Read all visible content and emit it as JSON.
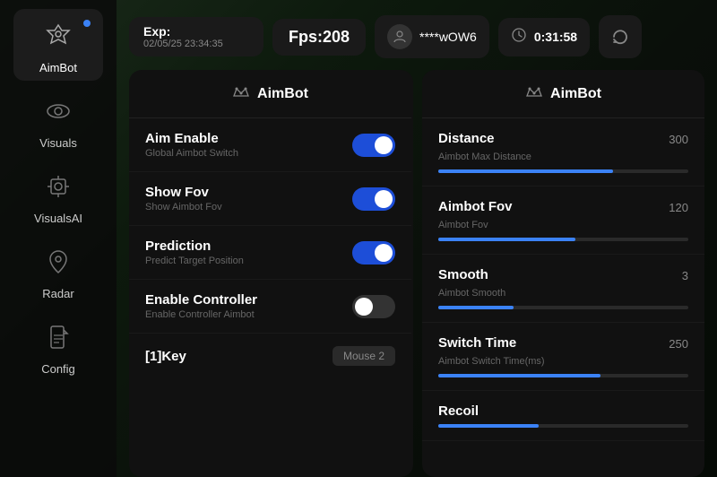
{
  "background": {
    "color": "#0a0a0a"
  },
  "sidebar": {
    "items": [
      {
        "id": "aimbot",
        "label": "AimBot",
        "icon": "crown",
        "active": true,
        "dot": true
      },
      {
        "id": "visuals",
        "label": "Visuals",
        "icon": "eye",
        "active": false,
        "dot": false
      },
      {
        "id": "visualsai",
        "label": "VisualsAI",
        "icon": "scan",
        "active": false,
        "dot": false
      },
      {
        "id": "radar",
        "label": "Radar",
        "icon": "location",
        "active": false,
        "dot": false
      },
      {
        "id": "config",
        "label": "Config",
        "icon": "file",
        "active": false,
        "dot": false
      }
    ]
  },
  "header": {
    "exp_label": "Exp:",
    "exp_date": "02/05/25 23:34:35",
    "fps_label": "Fps:208",
    "user_icon": "👤",
    "user_name": "****wOW6",
    "time_icon": "🕐",
    "time_value": "0:31:58",
    "refresh_icon": "↻"
  },
  "left_panel": {
    "title": "AimBot",
    "settings": [
      {
        "id": "aim-enable",
        "name": "Aim Enable",
        "desc": "Global Aimbot Switch",
        "type": "toggle",
        "value": true
      },
      {
        "id": "show-fov",
        "name": "Show Fov",
        "desc": "Show Aimbot Fov",
        "type": "toggle",
        "value": true
      },
      {
        "id": "prediction",
        "name": "Prediction",
        "desc": "Predict Target Position",
        "type": "toggle",
        "value": true
      },
      {
        "id": "enable-controller",
        "name": "Enable Controller",
        "desc": "Enable Controller Aimbot",
        "type": "toggle",
        "value": false
      },
      {
        "id": "key",
        "name": "[1]Key",
        "desc": "",
        "type": "key",
        "value": "Mouse 2"
      }
    ]
  },
  "right_panel": {
    "title": "AimBot",
    "settings": [
      {
        "id": "distance",
        "name": "Distance",
        "desc": "Aimbot Max Distance",
        "type": "slider",
        "value": 300,
        "max": 400,
        "fill_percent": 70
      },
      {
        "id": "aimbot-fov",
        "name": "Aimbot Fov",
        "desc": "Aimbot Fov",
        "type": "slider",
        "value": 120,
        "max": 200,
        "fill_percent": 55
      },
      {
        "id": "smooth",
        "name": "Smooth",
        "desc": "Aimbot Smooth",
        "type": "slider",
        "value": 3,
        "max": 10,
        "fill_percent": 30
      },
      {
        "id": "switch-time",
        "name": "Switch Time",
        "desc": "Aimbot Switch Time(ms)",
        "type": "slider",
        "value": 250,
        "max": 500,
        "fill_percent": 65
      },
      {
        "id": "recoil",
        "name": "Recoil",
        "desc": "",
        "type": "slider",
        "value": null,
        "max": 100,
        "fill_percent": 40
      }
    ]
  }
}
